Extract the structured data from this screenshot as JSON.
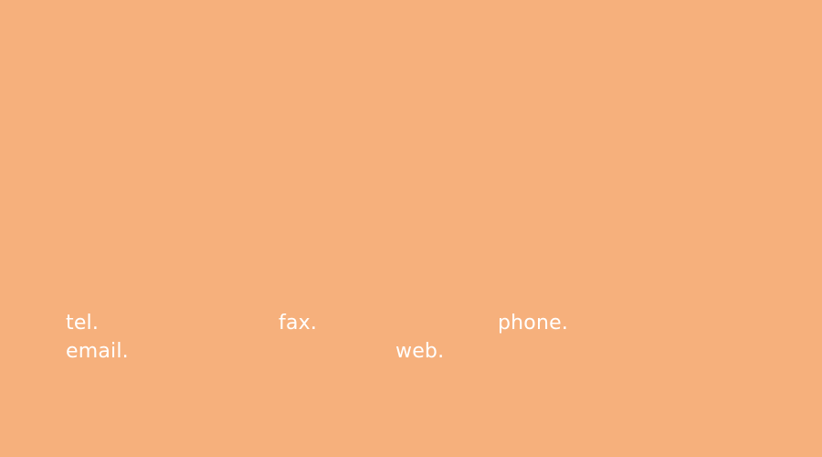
{
  "colors": {
    "background": "#f6b07c",
    "text": "#ffffff"
  },
  "contact": {
    "tel_label": "tel.",
    "fax_label": "fax.",
    "phone_label": "phone.",
    "email_label": "email.",
    "web_label": "web."
  }
}
